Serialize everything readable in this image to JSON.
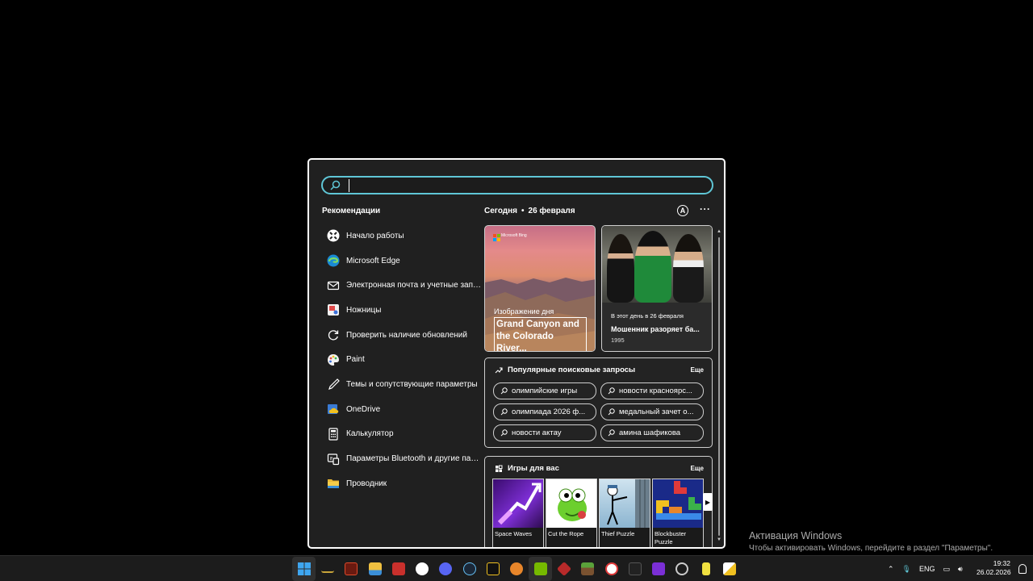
{
  "search": {
    "placeholder": ""
  },
  "recommendations": {
    "title": "Рекомендации",
    "items": [
      {
        "label": "Начало работы",
        "icon": "get-started-icon"
      },
      {
        "label": "Microsoft Edge",
        "icon": "edge-icon"
      },
      {
        "label": "Электронная почта и учетные записи",
        "icon": "mail-icon"
      },
      {
        "label": "Ножницы",
        "icon": "snipping-tool-icon"
      },
      {
        "label": "Проверить наличие обновлений",
        "icon": "update-icon"
      },
      {
        "label": "Paint",
        "icon": "paint-icon"
      },
      {
        "label": "Темы и сопутствующие параметры",
        "icon": "themes-icon"
      },
      {
        "label": "OneDrive",
        "icon": "onedrive-icon"
      },
      {
        "label": "Калькулятор",
        "icon": "calculator-icon"
      },
      {
        "label": "Параметры Bluetooth и другие пара...",
        "icon": "bluetooth-icon"
      },
      {
        "label": "Проводник",
        "icon": "explorer-icon"
      }
    ]
  },
  "today": {
    "label": "Сегодня",
    "sep": "•",
    "date": "26 февраля"
  },
  "image_card": {
    "brand": "Microsoft Bing",
    "label": "Изображение дня",
    "title": "Grand Canyon and the Colorado River..."
  },
  "history_card": {
    "small": "В этот день в 26 февраля",
    "headline": "Мошенник разоряет ба...",
    "year": "1995"
  },
  "popular": {
    "title": "Популярные поисковые запросы",
    "more": "Еще",
    "chips": [
      "олимпийские игры",
      "новости красноярс...",
      "олимпиада 2026 ф...",
      "медальный зачет о...",
      "новости актау",
      "амина шафикова"
    ]
  },
  "games": {
    "title": "Игры для вас",
    "more": "Еще",
    "items": [
      {
        "name": "Space Waves"
      },
      {
        "name": "Cut the Rope"
      },
      {
        "name": "Thief Puzzle"
      },
      {
        "name": "Blockbuster Puzzle"
      }
    ]
  },
  "activation": {
    "title": "Активация Windows",
    "subtitle": "Чтобы активировать Windows, перейдите в раздел \"Параметры\"."
  },
  "taskbar": {
    "lang": "ENG",
    "time": "19:32",
    "date": "26.02.2026",
    "colors": {
      "start": "#3ea6f0",
      "accent": "#5fc6d6"
    }
  }
}
